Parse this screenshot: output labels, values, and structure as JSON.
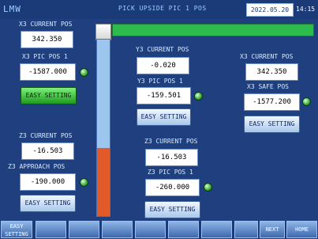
{
  "header": {
    "logo": "LMW",
    "title": "PICK UPSIDE PIC 1 POS",
    "date": "2022.05.20",
    "time": "14:15"
  },
  "left": {
    "x3_current_label": "X3 CURRENT POS",
    "x3_current_value": "342.350",
    "x3_pic_label": "X3 PIC POS 1",
    "x3_pic_value": "-1587.000",
    "easy_setting_top": "EASY SETTING",
    "z3_current_label": "Z3 CURRENT POS",
    "z3_current_value": "-16.503",
    "z3_approach_label": "Z3 APPROACH POS",
    "z3_approach_value": "-190.000",
    "easy_setting_bottom": "EASY SETTING"
  },
  "middle": {
    "y3_current_label": "Y3 CURRENT POS",
    "y3_current_value": "-0.020",
    "y3_pic_label": "Y3 PIC POS 1",
    "y3_pic_value": "-159.501",
    "easy_setting_y3": "EASY SETTING",
    "z3_current_label": "Z3 CURRENT POS",
    "z3_current_value": "-16.503",
    "z3_pic_label": "Z3 PIC POS 1",
    "z3_pic_value": "-260.000",
    "easy_setting_z3": "EASY SETTING"
  },
  "right": {
    "x3_current_label": "X3 CURRENT POS",
    "x3_current_value": "342.350",
    "x3_safe_label": "X3 SAFE POS",
    "x3_safe_value": "-1577.200",
    "easy_setting": "EASY SETTING"
  },
  "footer": {
    "easy_line1": "EASY",
    "easy_line2": "SETTING",
    "next": "NEXT",
    "home": "HOME"
  },
  "colors": {
    "background": "#1f3f7e",
    "active_green": "#2dbb4e",
    "red_segment": "#e05a2a",
    "lamp": "#3caa3c"
  }
}
